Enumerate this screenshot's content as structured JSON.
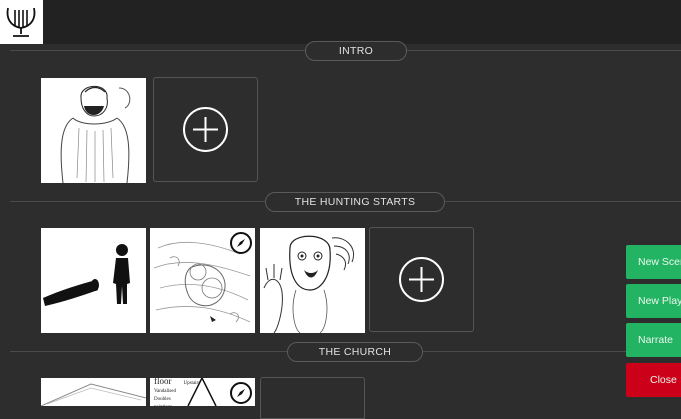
{
  "sections": [
    {
      "title": "INTRO"
    },
    {
      "title": "THE HUNTING STARTS"
    },
    {
      "title": "THE CHURCH"
    }
  ],
  "sidebar_buttons": [
    {
      "label": "New Scene",
      "color": "#23b463"
    },
    {
      "label": "New Playlist",
      "color": "#23b463"
    },
    {
      "label": "Narrate",
      "color": "#23b463"
    },
    {
      "label": "Close",
      "color": "#cc0019"
    }
  ],
  "church_thumb_text": {
    "line1": "floor",
    "line2": "Upstairs",
    "line3": "Vandalised",
    "line4": "Doubles",
    "line5": "paintings"
  },
  "icons": {
    "logo": "lyre-icon",
    "add": "plus-circle-icon",
    "nav": "compass-icon"
  }
}
